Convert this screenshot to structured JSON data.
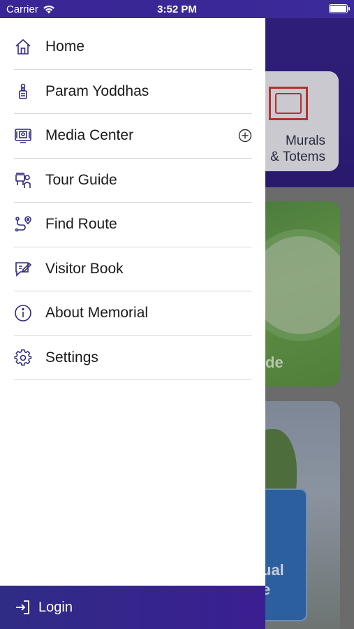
{
  "status_bar": {
    "carrier": "Carrier",
    "time": "3:52 PM"
  },
  "drawer": {
    "items": [
      {
        "label": "Home",
        "icon": "home-icon"
      },
      {
        "label": "Param Yoddhas",
        "icon": "medal-icon"
      },
      {
        "label": "Media Center",
        "icon": "media-icon",
        "expandable": true
      },
      {
        "label": "Tour Guide",
        "icon": "tour-guide-icon"
      },
      {
        "label": "Find Route",
        "icon": "route-icon"
      },
      {
        "label": "Visitor Book",
        "icon": "visitor-book-icon"
      },
      {
        "label": "About Memorial",
        "icon": "info-icon"
      },
      {
        "label": "Settings",
        "icon": "gear-icon"
      }
    ],
    "footer": {
      "label": "Login",
      "icon": "login-icon"
    }
  },
  "background": {
    "murals_card_label": "Murals\n& Totems",
    "green_card_text": "de",
    "sky_card_text": "ual\ne"
  },
  "colors": {
    "accent": "#2e2a7e",
    "header": "#3a2594"
  }
}
